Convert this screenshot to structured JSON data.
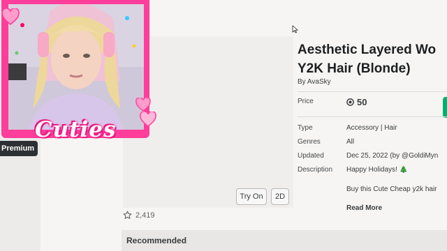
{
  "nav": {
    "premium_label": "Premium"
  },
  "item": {
    "title_line1": "Aesthetic Layered Wo",
    "title_line2": "Y2K Hair (Blonde)",
    "by_label": "By",
    "creator": "AvaSky",
    "favorites": "2,419",
    "price_label": "Price",
    "price_value": "50",
    "details": [
      {
        "label": "Type",
        "value": "Accessory | Hair"
      },
      {
        "label": "Genres",
        "value": "All"
      },
      {
        "label": "Updated",
        "value": "Dec 25, 2022 (by @GoldiMyn"
      },
      {
        "label": "Description",
        "value": "Happy Holidays! 🎄"
      }
    ],
    "description_more": "Buy this Cute Cheap y2k hair",
    "read_more": "Read More"
  },
  "thumbnail": {
    "try_on": "Try On",
    "view_2d": "2D"
  },
  "recommended": {
    "heading": "Recommended"
  },
  "overlay": {
    "caption": "Cuties"
  },
  "colors": {
    "accent_green": "#00b06f",
    "overlay_pink": "#ff3d9a"
  },
  "icons": [
    "robux-icon",
    "star-icon",
    "cursor-icon",
    "heart-icon"
  ]
}
